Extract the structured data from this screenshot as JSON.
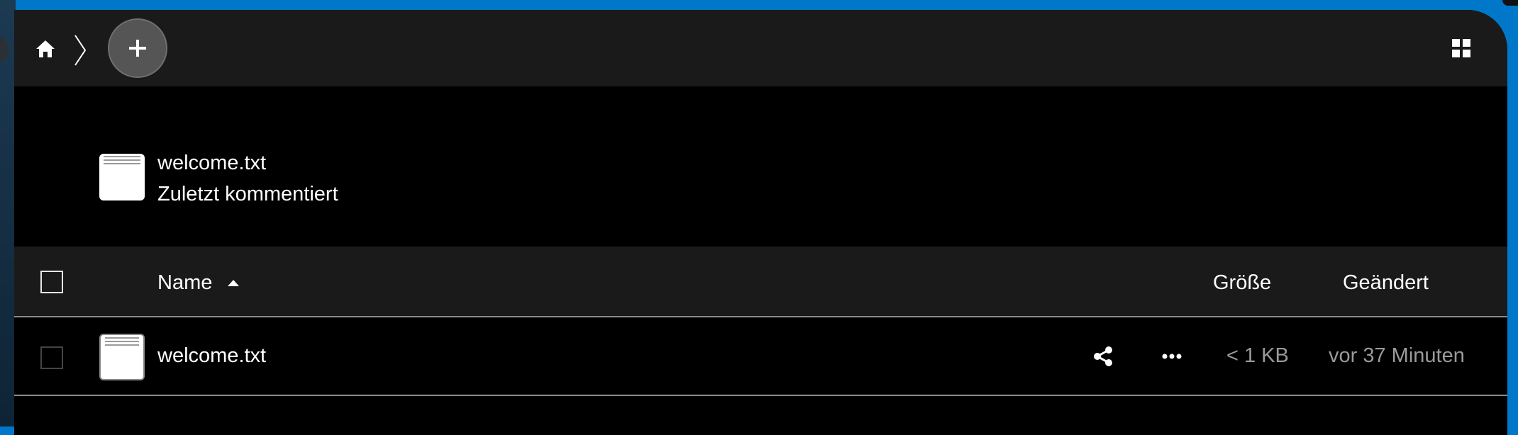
{
  "header": {
    "home_icon": "home-icon",
    "separator_icon": "chevron-right-icon",
    "add_label": "+",
    "view_toggle_icon": "grid-view-icon"
  },
  "recent": {
    "file_name": "welcome.txt",
    "subtitle": "Zuletzt kommentiert"
  },
  "table": {
    "columns": {
      "name": "Name",
      "size": "Größe",
      "modified": "Geändert"
    },
    "sort": "ascending",
    "rows": [
      {
        "name": "welcome.txt",
        "size": "< 1 KB",
        "modified": "vor 37 Minuten",
        "actions": [
          "share-icon",
          "more-icon"
        ]
      }
    ]
  },
  "colors": {
    "desktop_blue": "#0077c8",
    "header_bg": "#1a1a1a",
    "content_bg": "#000000",
    "muted_text": "#9a9a9a"
  }
}
